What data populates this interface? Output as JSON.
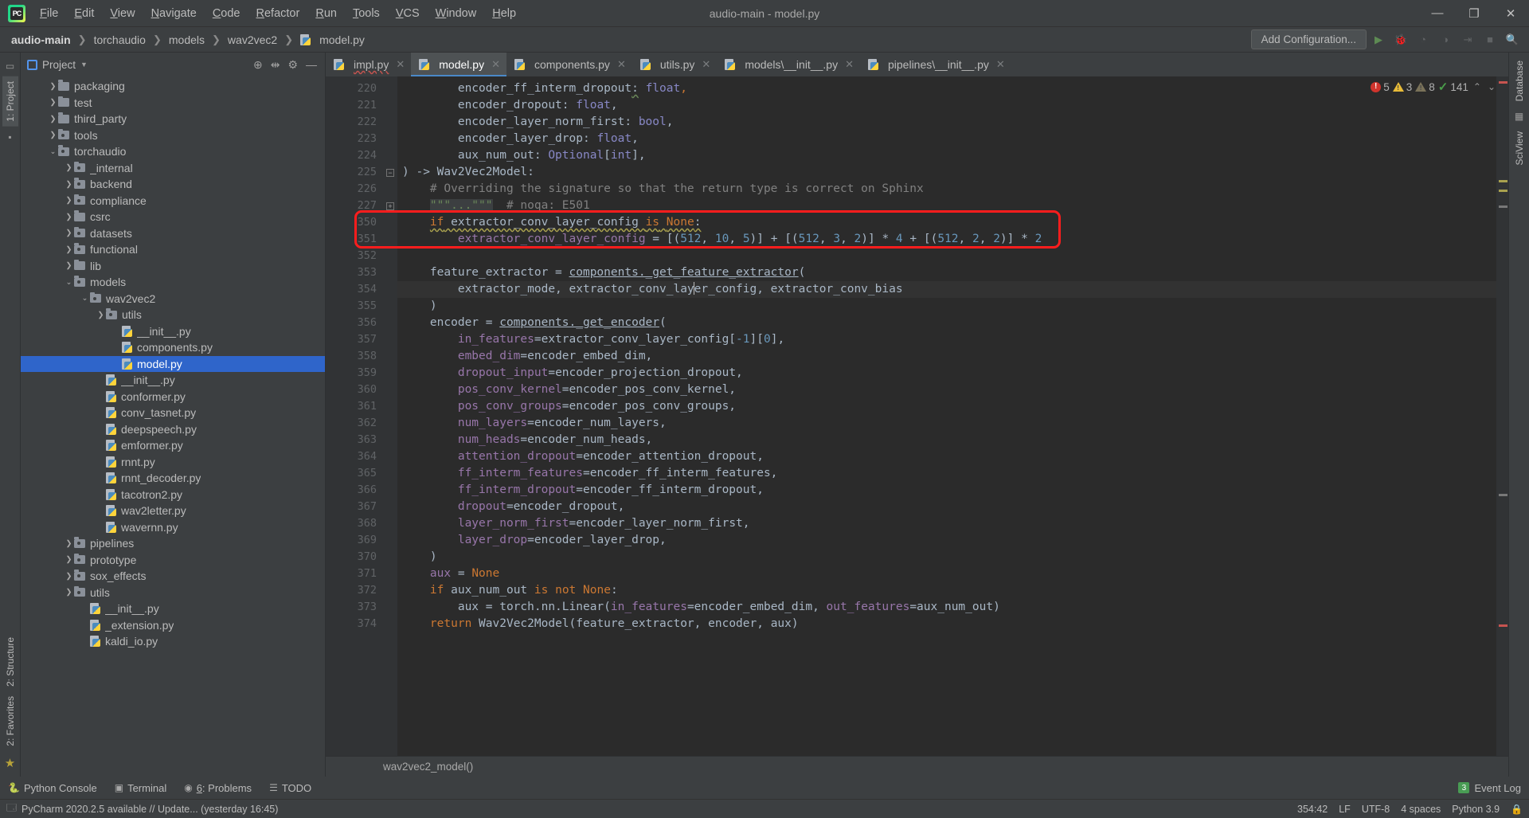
{
  "window": {
    "title": "audio-main - model.py",
    "controls": {
      "minimize": "—",
      "maximize": "❐",
      "close": "✕"
    }
  },
  "menubar": [
    {
      "label": "File"
    },
    {
      "label": "Edit"
    },
    {
      "label": "View"
    },
    {
      "label": "Navigate"
    },
    {
      "label": "Code"
    },
    {
      "label": "Refactor"
    },
    {
      "label": "Run"
    },
    {
      "label": "Tools"
    },
    {
      "label": "VCS"
    },
    {
      "label": "Window"
    },
    {
      "label": "Help"
    }
  ],
  "breadcrumbs": [
    {
      "label": "audio-main",
      "bold": true
    },
    {
      "label": "torchaudio"
    },
    {
      "label": "models"
    },
    {
      "label": "wav2vec2"
    },
    {
      "label": "model.py",
      "icon": "python-file-icon"
    }
  ],
  "nav_right": {
    "add_configuration": "Add Configuration...",
    "icons": [
      "run-icon",
      "debug-icon",
      "coverage-icon",
      "profile-icon",
      "run-with-icon",
      "stop-icon",
      "search-everywhere-icon"
    ]
  },
  "left_strip": [
    {
      "label": "1: Project",
      "icon": "project-icon",
      "selected": true
    },
    {
      "label": "",
      "icon": "favorites-bookmark-icon",
      "selected": false
    }
  ],
  "left_strip_bottom": [
    {
      "label": "2: Structure",
      "icon": "structure-icon"
    },
    {
      "label": "2: Favorites",
      "icon": "favorites-icon"
    },
    {
      "label": "",
      "icon": "star-icon"
    }
  ],
  "right_strip": [
    {
      "label": "Database",
      "icon": "database-icon"
    },
    {
      "label": "SciView",
      "icon": "sciview-icon"
    }
  ],
  "project_panel": {
    "title": "Project",
    "dropdown_icon": "chevron-down-icon",
    "actions": [
      "target-icon",
      "collapse-all-icon",
      "settings-gear-icon",
      "hide-icon"
    ],
    "tree": [
      {
        "label": "packaging",
        "indent": 1,
        "type": "folder",
        "arrow": "collapsed"
      },
      {
        "label": "test",
        "indent": 1,
        "type": "folder",
        "arrow": "collapsed"
      },
      {
        "label": "third_party",
        "indent": 1,
        "type": "folder",
        "arrow": "collapsed"
      },
      {
        "label": "tools",
        "indent": 1,
        "type": "source",
        "arrow": "collapsed"
      },
      {
        "label": "torchaudio",
        "indent": 1,
        "type": "source",
        "arrow": "expanded",
        "spell": true
      },
      {
        "label": "_internal",
        "indent": 2,
        "type": "source",
        "arrow": "collapsed"
      },
      {
        "label": "backend",
        "indent": 2,
        "type": "source",
        "arrow": "collapsed"
      },
      {
        "label": "compliance",
        "indent": 2,
        "type": "source",
        "arrow": "collapsed"
      },
      {
        "label": "csrc",
        "indent": 2,
        "type": "folder",
        "arrow": "collapsed"
      },
      {
        "label": "datasets",
        "indent": 2,
        "type": "source",
        "arrow": "collapsed"
      },
      {
        "label": "functional",
        "indent": 2,
        "type": "source",
        "arrow": "collapsed"
      },
      {
        "label": "lib",
        "indent": 2,
        "type": "folder",
        "arrow": "collapsed"
      },
      {
        "label": "models",
        "indent": 2,
        "type": "source",
        "arrow": "expanded"
      },
      {
        "label": "wav2vec2",
        "indent": 3,
        "type": "source",
        "arrow": "expanded"
      },
      {
        "label": "utils",
        "indent": 4,
        "type": "source",
        "arrow": "collapsed"
      },
      {
        "label": "__init__.py",
        "indent": 5,
        "type": "python",
        "arrow": "none"
      },
      {
        "label": "components.py",
        "indent": 5,
        "type": "python",
        "arrow": "none"
      },
      {
        "label": "model.py",
        "indent": 5,
        "type": "python",
        "arrow": "none",
        "selected": true
      },
      {
        "label": "__init__.py",
        "indent": 4,
        "type": "python",
        "arrow": "none"
      },
      {
        "label": "conformer.py",
        "indent": 4,
        "type": "python",
        "arrow": "none"
      },
      {
        "label": "conv_tasnet.py",
        "indent": 4,
        "type": "python",
        "arrow": "none"
      },
      {
        "label": "deepspeech.py",
        "indent": 4,
        "type": "python",
        "arrow": "none"
      },
      {
        "label": "emformer.py",
        "indent": 4,
        "type": "python",
        "arrow": "none"
      },
      {
        "label": "rnnt.py",
        "indent": 4,
        "type": "python",
        "arrow": "none"
      },
      {
        "label": "rnnt_decoder.py",
        "indent": 4,
        "type": "python",
        "arrow": "none"
      },
      {
        "label": "tacotron2.py",
        "indent": 4,
        "type": "python",
        "arrow": "none"
      },
      {
        "label": "wav2letter.py",
        "indent": 4,
        "type": "python",
        "arrow": "none"
      },
      {
        "label": "wavernn.py",
        "indent": 4,
        "type": "python",
        "arrow": "none"
      },
      {
        "label": "pipelines",
        "indent": 2,
        "type": "source",
        "arrow": "collapsed",
        "spell": true
      },
      {
        "label": "prototype",
        "indent": 2,
        "type": "source",
        "arrow": "collapsed"
      },
      {
        "label": "sox_effects",
        "indent": 2,
        "type": "source",
        "arrow": "collapsed"
      },
      {
        "label": "utils",
        "indent": 2,
        "type": "source",
        "arrow": "collapsed"
      },
      {
        "label": "__init__.py",
        "indent": 3,
        "type": "python",
        "arrow": "none"
      },
      {
        "label": "_extension.py",
        "indent": 3,
        "type": "python",
        "arrow": "none"
      },
      {
        "label": "kaldi_io.py",
        "indent": 3,
        "type": "python",
        "arrow": "none"
      }
    ]
  },
  "editor_tabs": [
    {
      "label": "impl.py",
      "active": false,
      "error": true
    },
    {
      "label": "model.py",
      "active": true,
      "error": false
    },
    {
      "label": "components.py",
      "active": false,
      "error": false
    },
    {
      "label": "utils.py",
      "active": false,
      "error": false
    },
    {
      "label": "models\\__init__.py",
      "active": false,
      "error": false
    },
    {
      "label": "pipelines\\__init__.py",
      "active": false,
      "error": false
    }
  ],
  "inspections": {
    "errors": "5",
    "warnings": "3",
    "weak_warnings": "8",
    "passed": "141",
    "up_icon": "chevron-up-icon",
    "down_icon": "chevron-down-icon"
  },
  "editor": {
    "line_numbers": [
      "220",
      "221",
      "222",
      "223",
      "224",
      "225",
      "226",
      "227",
      "350",
      "351",
      "352",
      "353",
      "354",
      "355",
      "356",
      "357",
      "358",
      "359",
      "360",
      "361",
      "362",
      "363",
      "364",
      "365",
      "366",
      "367",
      "368",
      "369",
      "370",
      "371",
      "372",
      "373",
      "374"
    ],
    "lines": [
      "        encoder_ff_interm_dropout: float,",
      "        encoder_dropout: float,",
      "        encoder_layer_norm_first: bool,",
      "        encoder_layer_drop: float,",
      "        aux_num_out: Optional[int],",
      ") -> Wav2Vec2Model:",
      "    # Overriding the signature so that the return type is correct on Sphinx",
      "    \"\"\"...\"\"\"  # noqa: E501",
      "    if extractor_conv_layer_config is None:",
      "        extractor_conv_layer_config = [(512, 10, 5)] + [(512, 3, 2)] * 4 + [(512, 2, 2)] * 2",
      "",
      "    feature_extractor = components._get_feature_extractor(",
      "        extractor_mode, extractor_conv_layer_config, extractor_conv_bias",
      "    )",
      "    encoder = components._get_encoder(",
      "        in_features=extractor_conv_layer_config[-1][0],",
      "        embed_dim=encoder_embed_dim,",
      "        dropout_input=encoder_projection_dropout,",
      "        pos_conv_kernel=encoder_pos_conv_kernel,",
      "        pos_conv_groups=encoder_pos_conv_groups,",
      "        num_layers=encoder_num_layers,",
      "        num_heads=encoder_num_heads,",
      "        attention_dropout=encoder_attention_dropout,",
      "        ff_interm_features=encoder_ff_interm_features,",
      "        ff_interm_dropout=encoder_ff_interm_dropout,",
      "        dropout=encoder_dropout,",
      "        layer_norm_first=encoder_layer_norm_first,",
      "        layer_drop=encoder_layer_drop,",
      "    )",
      "    aux = None",
      "    if aux_num_out is not None:",
      "        aux = torch.nn.Linear(in_features=encoder_embed_dim, out_features=aux_num_out)",
      "    return Wav2Vec2Model(feature_extractor, encoder, aux)"
    ],
    "highlight_box": {
      "color": "#fd1d1d",
      "start_line": "350",
      "end_line": "352"
    },
    "footer_breadcrumb": "wav2vec2_model()"
  },
  "bottom_toolwindows": [
    {
      "label": "TODO",
      "icon": "todo-icon",
      "shortcut": ""
    },
    {
      "label": "Problems",
      "icon": "problems-icon",
      "shortcut": "6"
    },
    {
      "label": "Terminal",
      "icon": "terminal-icon",
      "shortcut": ""
    },
    {
      "label": "Python Console",
      "icon": "python-console-icon",
      "shortcut": ""
    }
  ],
  "event_log": {
    "label": "Event Log",
    "count": "3"
  },
  "statusbar": {
    "message": "PyCharm 2020.2.5 available // Update... (yesterday 16:45)",
    "message_icon": "update-notification-icon",
    "caret_position": "354:42",
    "line_separator": "LF",
    "encoding": "UTF-8",
    "indent": "4 spaces",
    "interpreter": "Python 3.9",
    "lock_icon": "lock-icon"
  },
  "colors": {
    "accent": "#4a88c7",
    "error": "#c75450",
    "warning": "#e8bb38",
    "ok": "#499c54",
    "selection": "#2f65ca",
    "highlight_box": "#fd1d1d"
  }
}
